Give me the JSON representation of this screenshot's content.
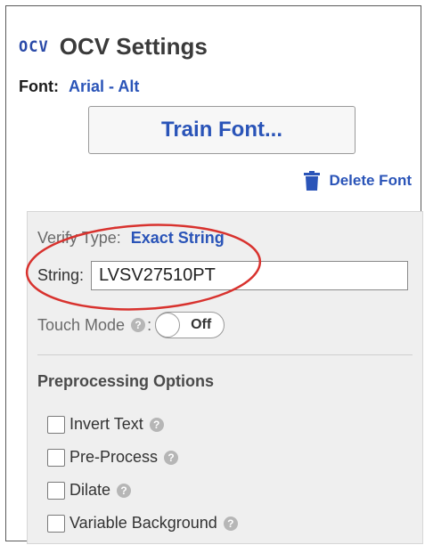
{
  "header": {
    "logo": "OCV",
    "title": "OCV Settings"
  },
  "font": {
    "label": "Font:",
    "value": "Arial - Alt"
  },
  "actions": {
    "train_label": "Train Font...",
    "delete_label": "Delete Font"
  },
  "verify": {
    "label": "Verify Type:",
    "value": "Exact String"
  },
  "string": {
    "label": "String:",
    "value": "LVSV27510PT"
  },
  "touch_mode": {
    "label": "Touch Mode",
    "colon": ":",
    "help": "?",
    "state": "Off"
  },
  "preprocessing": {
    "title": "Preprocessing Options",
    "options": [
      {
        "label": "Invert Text",
        "checked": false,
        "help": "?"
      },
      {
        "label": "Pre-Process",
        "checked": false,
        "help": "?"
      },
      {
        "label": "Dilate",
        "checked": false,
        "help": "?"
      },
      {
        "label": "Variable Background",
        "checked": false,
        "help": "?"
      }
    ]
  },
  "colors": {
    "accent": "#2a54b8",
    "annotation": "#d8322e",
    "panel": "#efefef"
  }
}
